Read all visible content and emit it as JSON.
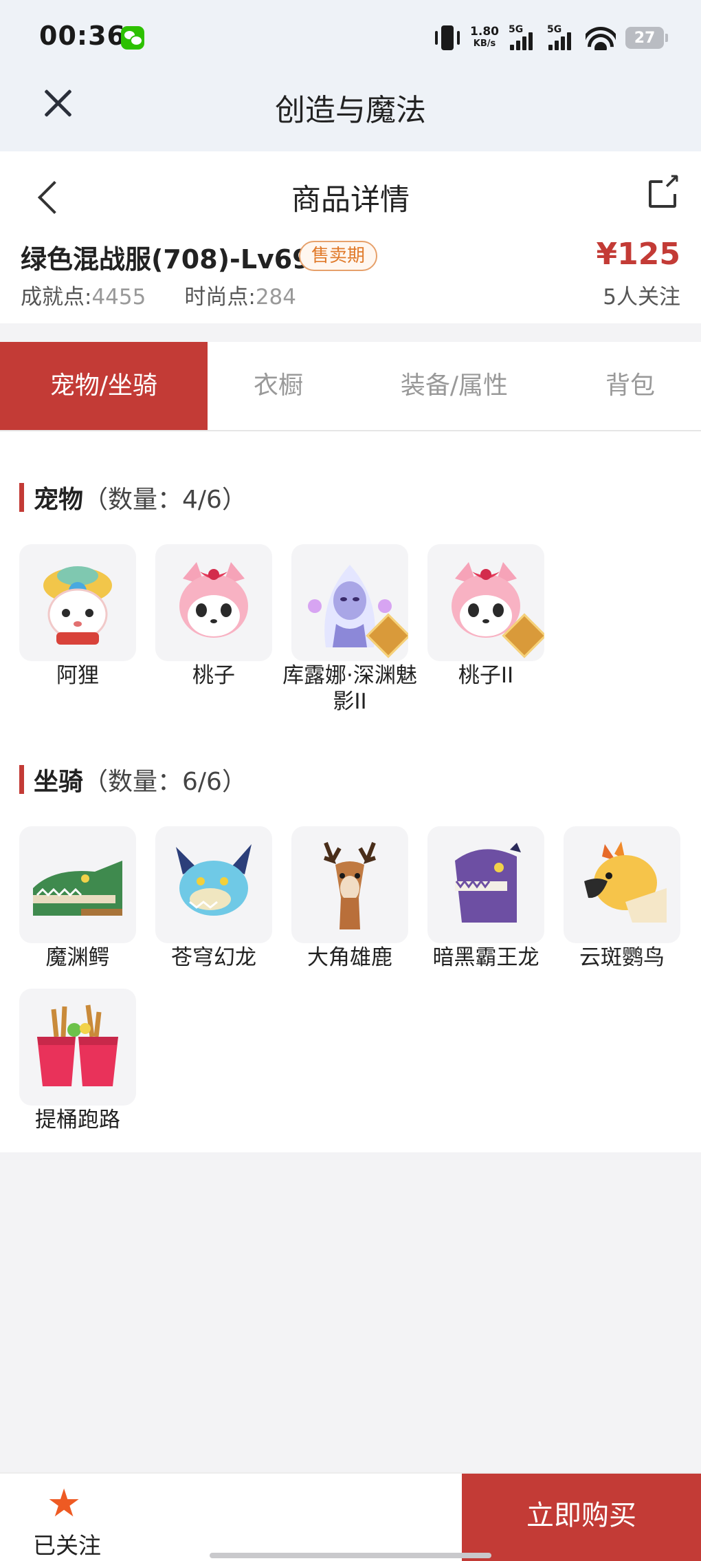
{
  "status_bar": {
    "time": "00:36",
    "net_speed_value": "1.80",
    "net_speed_unit": "KB/s",
    "sim1": "5G",
    "sim2": "5G",
    "battery": "27"
  },
  "app_bar": {
    "title": "创造与魔法"
  },
  "header": {
    "title": "商品详情",
    "item_name": "绿色混战服(708)-Lv69",
    "sale_badge": "售卖期",
    "achievement_label": "成就点:",
    "achievement_value": "4455",
    "fashion_label": "时尚点:",
    "fashion_value": "284",
    "price": "¥125",
    "followers": "5人关注"
  },
  "tabs": [
    {
      "label": "宠物/坐骑",
      "active": true
    },
    {
      "label": "衣橱",
      "active": false
    },
    {
      "label": "装备/属性",
      "active": false
    },
    {
      "label": "背包",
      "active": false
    }
  ],
  "pets": {
    "title": "宠物",
    "count": "（数量：4/6）",
    "items": [
      {
        "name": "阿狸",
        "icon": "ali-pet-icon"
      },
      {
        "name": "桃子",
        "icon": "taozi-pet-icon"
      },
      {
        "name": "库露娜·深渊魅影II",
        "icon": "kuluna-pet-icon"
      },
      {
        "name": "桃子II",
        "icon": "taozi2-pet-icon"
      }
    ]
  },
  "mounts": {
    "title": "坐骑",
    "count": "（数量：6/6）",
    "items": [
      {
        "name": "魔渊鳄",
        "icon": "crocodile-mount-icon"
      },
      {
        "name": "苍穹幻龙",
        "icon": "dragon-mount-icon"
      },
      {
        "name": "大角雄鹿",
        "icon": "deer-mount-icon"
      },
      {
        "name": "暗黑霸王龙",
        "icon": "trex-mount-icon"
      },
      {
        "name": "云斑鹦鸟",
        "icon": "parrot-mount-icon"
      },
      {
        "name": "提桶跑路",
        "icon": "bucket-mount-icon"
      }
    ]
  },
  "bottom_bar": {
    "follow_label": "已关注",
    "buy_label": "立即购买"
  },
  "colors": {
    "accent": "#c33b36",
    "star": "#ee5a23",
    "badge": "#e07a2a"
  }
}
